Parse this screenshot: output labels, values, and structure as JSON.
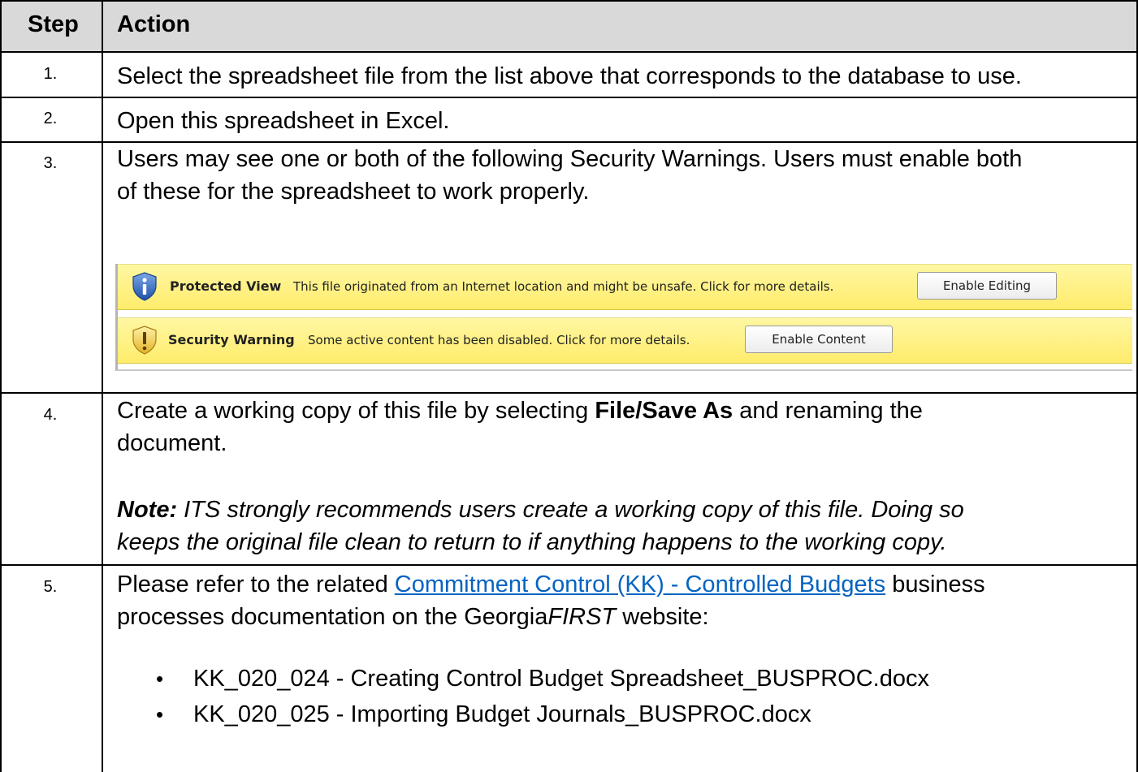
{
  "header": {
    "step": "Step",
    "action": "Action"
  },
  "rows": [
    {
      "num": "1.",
      "text": "Select the spreadsheet file from the list above that corresponds to the database to use."
    },
    {
      "num": "2.",
      "text": "Open this spreadsheet in Excel."
    },
    {
      "num": "3.",
      "text_line1": "Users may see one or both of the following Security Warnings.  Users must enable both",
      "text_line2": "of these for the spreadsheet to work properly."
    },
    {
      "num": "4.",
      "line1_pre": "Create a working copy of this file by selecting ",
      "line1_bold": "File/Save As",
      "line1_post": " and renaming the",
      "line2": "document.",
      "note_label": "Note:",
      "note_line1": " ITS strongly recommends users create a working copy of this file. Doing so",
      "note_line2": "keeps the original file clean to return to if anything happens to the working copy."
    },
    {
      "num": "5.",
      "pre_link": "Please refer to the related ",
      "link": "Commitment Control (KK) - Controlled Budgets",
      "post_link": " business",
      "line2_pre": "processes documentation on the Georgia",
      "line2_italic": "FIRST",
      "line2_post": " website:",
      "bullets": [
        "KK_020_024 - Creating Control Budget Spreadsheet_BUSPROC.docx",
        "KK_020_025 - Importing Budget Journals_BUSPROC.docx"
      ]
    }
  ],
  "protected_bar": {
    "title": "Protected View",
    "message": "This file originated from an Internet location and might be unsafe. Click for more details.",
    "button": "Enable Editing",
    "icon": "info-shield-icon"
  },
  "security_bar": {
    "title": "Security Warning",
    "message": "Some active content has been disabled. Click for more details.",
    "button": "Enable Content",
    "icon": "warning-shield-icon"
  },
  "colors": {
    "header_bg": "#d9d9d9",
    "link": "#0563c1",
    "bar_yellow": "#fff29a"
  }
}
